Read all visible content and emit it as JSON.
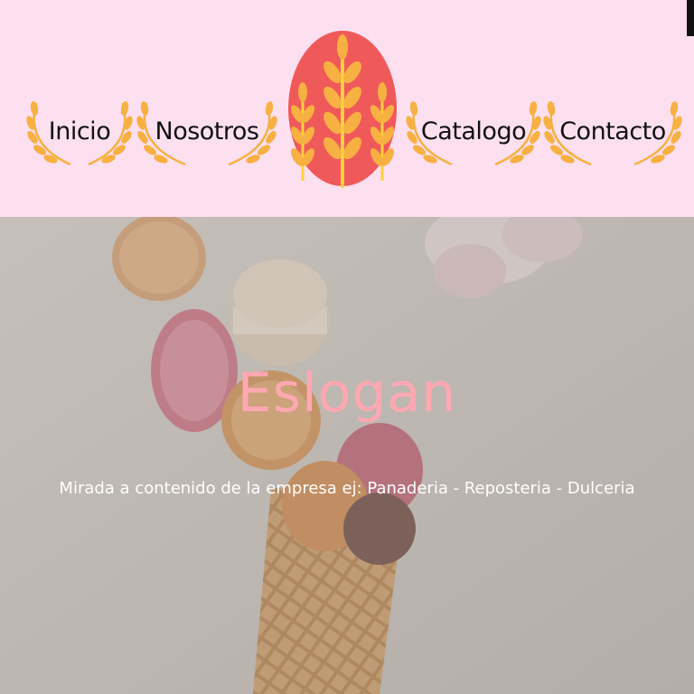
{
  "header": {
    "background_color": "#fde0f0",
    "logo_icon": "wheat-logo-icon",
    "logo_color": "#f0595a",
    "wreath_color": "#f7b042",
    "nav": [
      {
        "label": "Inicio",
        "icon": "laurel-wreath-icon"
      },
      {
        "label": "Nosotros",
        "icon": "laurel-wreath-icon"
      },
      {
        "label": "Catalogo",
        "icon": "laurel-wreath-icon"
      },
      {
        "label": "Contacto",
        "icon": "laurel-wreath-icon"
      }
    ]
  },
  "hero": {
    "slogan": "Eslogan",
    "slogan_color": "#ffa8b2",
    "subtitle": "Mirada a contenido de la empresa ej: Panaderia - Reposteria - Dulceria",
    "image": "macarons-and-waffle-cone-photo"
  }
}
